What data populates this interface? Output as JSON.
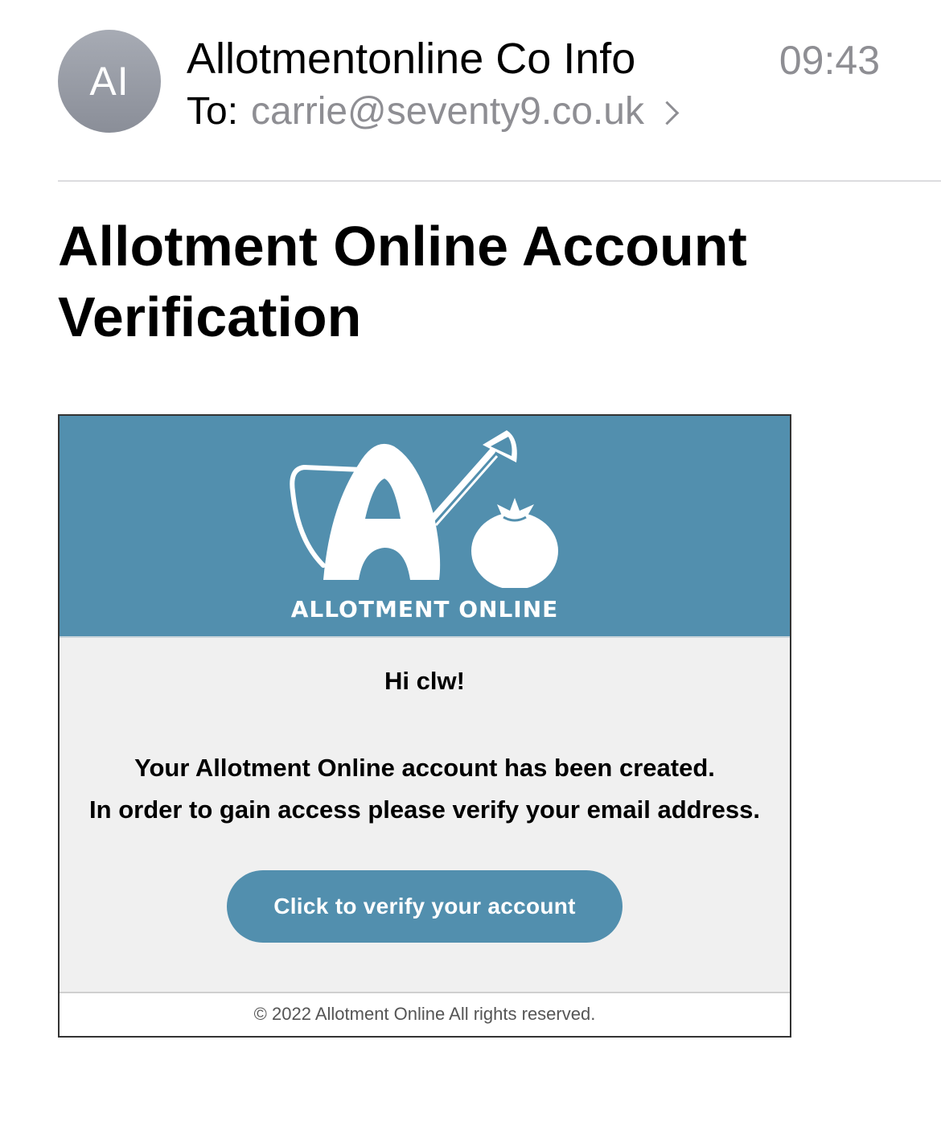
{
  "header": {
    "avatar_initials": "AI",
    "sender": "Allotmentonline Co Info",
    "time": "09:43",
    "to_label": "To:",
    "to_address": "carrie@seventy9.co.uk"
  },
  "subject": "Allotment Online Account Verification",
  "email": {
    "brand": "ALLOTMENT ONLINE",
    "greeting": "Hi clw!",
    "line1": "Your Allotment Online account has been created.",
    "line2": "In order to gain access please verify your email address.",
    "verify_button": "Click to verify your account",
    "footer": "© 2022 Allotment Online All rights reserved."
  },
  "colors": {
    "brand_blue": "#528fae",
    "card_bg": "#f0f0f0",
    "secondary_text": "#8e8e93"
  },
  "icons": {
    "chevron": "chevron-right-icon",
    "logo": "allotment-online-logo"
  }
}
